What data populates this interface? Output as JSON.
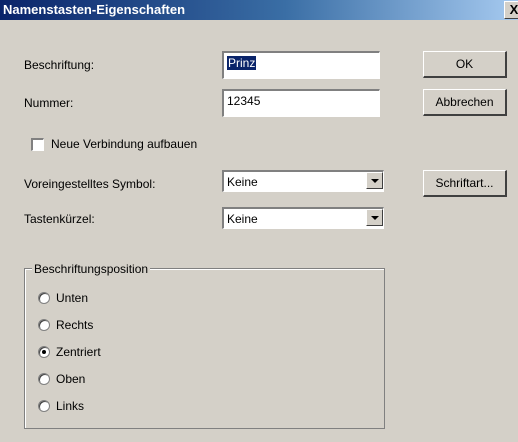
{
  "window": {
    "title": "Namenstasten-Eigenschaften",
    "close_glyph": "X"
  },
  "form": {
    "caption_label": "Beschriftung:",
    "caption_value": "Prinz",
    "number_label": "Nummer:",
    "number_value": "12345",
    "new_connection_label": "Neue Verbindung aufbauen",
    "default_symbol_label": "Voreingestelltes Symbol:",
    "default_symbol_value": "Keine",
    "shortcut_label": "Tastenkürzel:",
    "shortcut_value": "Keine"
  },
  "buttons": {
    "ok": "OK",
    "cancel": "Abbrechen",
    "font": "Schriftart..."
  },
  "position_group": {
    "title": "Beschriftungsposition",
    "options": [
      "Unten",
      "Rechts",
      "Zentriert",
      "Oben",
      "Links"
    ],
    "selected": "Zentriert"
  }
}
